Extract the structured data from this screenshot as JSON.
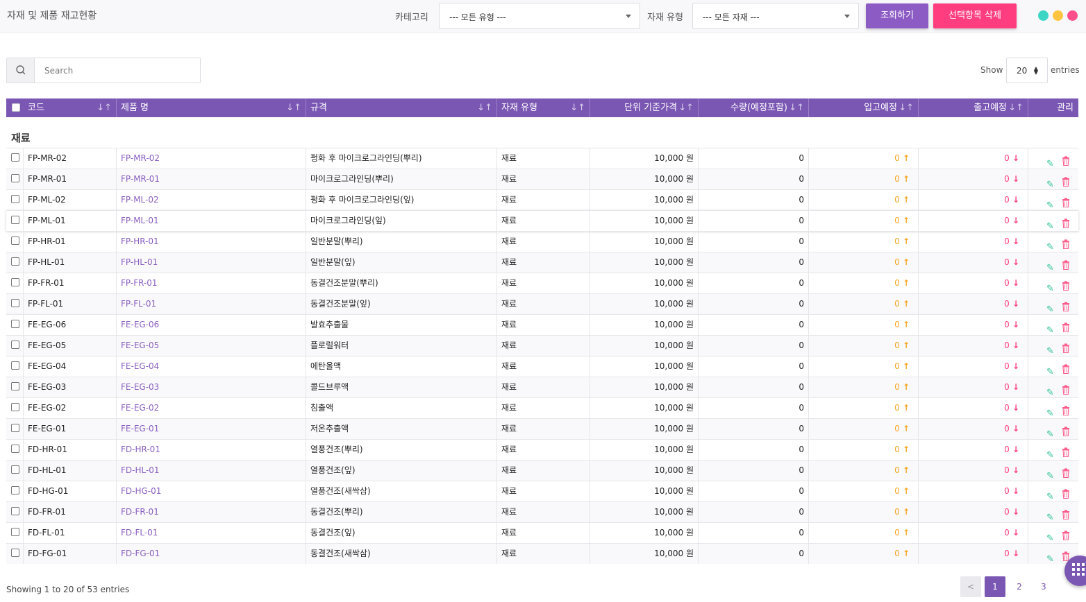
{
  "header": {
    "title": "자재 및 제품 재고현황",
    "category_label": "카테고리",
    "category_value": "--- 모든 유형 ---",
    "material_type_label": "자재 유형",
    "material_type_value": "--- 모든 자재 ---",
    "search_button": "조회하기",
    "delete_button": "선택항목 삭제",
    "dot_colors": [
      "#3dd6c4",
      "#ffc542",
      "#ff4f8b"
    ]
  },
  "toolbar": {
    "search_placeholder": "Search",
    "show_label": "Show",
    "show_value": "20",
    "entries_label": "entries"
  },
  "table": {
    "columns": [
      "코드",
      "제품 명",
      "규격",
      "자재 유형",
      "단위 기준가격",
      "수량(예정포함)",
      "입고예정",
      "출고예정",
      "관리"
    ],
    "group_title": "재료",
    "rows": [
      {
        "code": "FP-MR-02",
        "name": "FP-MR-02",
        "spec": "펑화 후 마이크로그라인딩(뿌리)",
        "type": "재료",
        "price": "10,000 원",
        "qty": "0",
        "in": "0",
        "out": "0"
      },
      {
        "code": "FP-MR-01",
        "name": "FP-MR-01",
        "spec": "마이크로그라인딩(뿌리)",
        "type": "재료",
        "price": "10,000 원",
        "qty": "0",
        "in": "0",
        "out": "0"
      },
      {
        "code": "FP-ML-02",
        "name": "FP-ML-02",
        "spec": "펑화 후 마이크로그라인딩(잎)",
        "type": "재료",
        "price": "10,000 원",
        "qty": "0",
        "in": "0",
        "out": "0"
      },
      {
        "code": "FP-ML-01",
        "name": "FP-ML-01",
        "spec": "마이크로그라인딩(잎)",
        "type": "재료",
        "price": "10,000 원",
        "qty": "0",
        "in": "0",
        "out": "0"
      },
      {
        "code": "FP-HR-01",
        "name": "FP-HR-01",
        "spec": "일반분말(뿌리)",
        "type": "재료",
        "price": "10,000 원",
        "qty": "0",
        "in": "0",
        "out": "0"
      },
      {
        "code": "FP-HL-01",
        "name": "FP-HL-01",
        "spec": "일반분말(잎)",
        "type": "재료",
        "price": "10,000 원",
        "qty": "0",
        "in": "0",
        "out": "0"
      },
      {
        "code": "FP-FR-01",
        "name": "FP-FR-01",
        "spec": "동결건조분말(뿌리)",
        "type": "재료",
        "price": "10,000 원",
        "qty": "0",
        "in": "0",
        "out": "0"
      },
      {
        "code": "FP-FL-01",
        "name": "FP-FL-01",
        "spec": "동결건조분말(잎)",
        "type": "재료",
        "price": "10,000 원",
        "qty": "0",
        "in": "0",
        "out": "0"
      },
      {
        "code": "FE-EG-06",
        "name": "FE-EG-06",
        "spec": "발효추출물",
        "type": "재료",
        "price": "10,000 원",
        "qty": "0",
        "in": "0",
        "out": "0"
      },
      {
        "code": "FE-EG-05",
        "name": "FE-EG-05",
        "spec": "플로럴워터",
        "type": "재료",
        "price": "10,000 원",
        "qty": "0",
        "in": "0",
        "out": "0"
      },
      {
        "code": "FE-EG-04",
        "name": "FE-EG-04",
        "spec": "에탄올액",
        "type": "재료",
        "price": "10,000 원",
        "qty": "0",
        "in": "0",
        "out": "0"
      },
      {
        "code": "FE-EG-03",
        "name": "FE-EG-03",
        "spec": "콜드브루액",
        "type": "재료",
        "price": "10,000 원",
        "qty": "0",
        "in": "0",
        "out": "0"
      },
      {
        "code": "FE-EG-02",
        "name": "FE-EG-02",
        "spec": "침출액",
        "type": "재료",
        "price": "10,000 원",
        "qty": "0",
        "in": "0",
        "out": "0"
      },
      {
        "code": "FE-EG-01",
        "name": "FE-EG-01",
        "spec": "저온추출액",
        "type": "재료",
        "price": "10,000 원",
        "qty": "0",
        "in": "0",
        "out": "0"
      },
      {
        "code": "FD-HR-01",
        "name": "FD-HR-01",
        "spec": "열풍건조(뿌리)",
        "type": "재료",
        "price": "10,000 원",
        "qty": "0",
        "in": "0",
        "out": "0"
      },
      {
        "code": "FD-HL-01",
        "name": "FD-HL-01",
        "spec": "열풍건조(잎)",
        "type": "재료",
        "price": "10,000 원",
        "qty": "0",
        "in": "0",
        "out": "0"
      },
      {
        "code": "FD-HG-01",
        "name": "FD-HG-01",
        "spec": "열풍건조(새싹삼)",
        "type": "재료",
        "price": "10,000 원",
        "qty": "0",
        "in": "0",
        "out": "0"
      },
      {
        "code": "FD-FR-01",
        "name": "FD-FR-01",
        "spec": "동결건조(뿌리)",
        "type": "재료",
        "price": "10,000 원",
        "qty": "0",
        "in": "0",
        "out": "0"
      },
      {
        "code": "FD-FL-01",
        "name": "FD-FL-01",
        "spec": "동결건조(잎)",
        "type": "재료",
        "price": "10,000 원",
        "qty": "0",
        "in": "0",
        "out": "0"
      },
      {
        "code": "FD-FG-01",
        "name": "FD-FG-01",
        "spec": "동결건조(새싹삼)",
        "type": "재료",
        "price": "10,000 원",
        "qty": "0",
        "in": "0",
        "out": "0"
      }
    ]
  },
  "footer": {
    "info": "Showing 1 to 20 of 53 entries",
    "pages": [
      "1",
      "2",
      "3"
    ],
    "active_page": "1"
  },
  "colors": {
    "accent": "#7b57b4",
    "delete": "#ff3d7f",
    "inbound": "#f5a623",
    "outbound": "#ff3d7f",
    "edit": "#33c29a"
  }
}
